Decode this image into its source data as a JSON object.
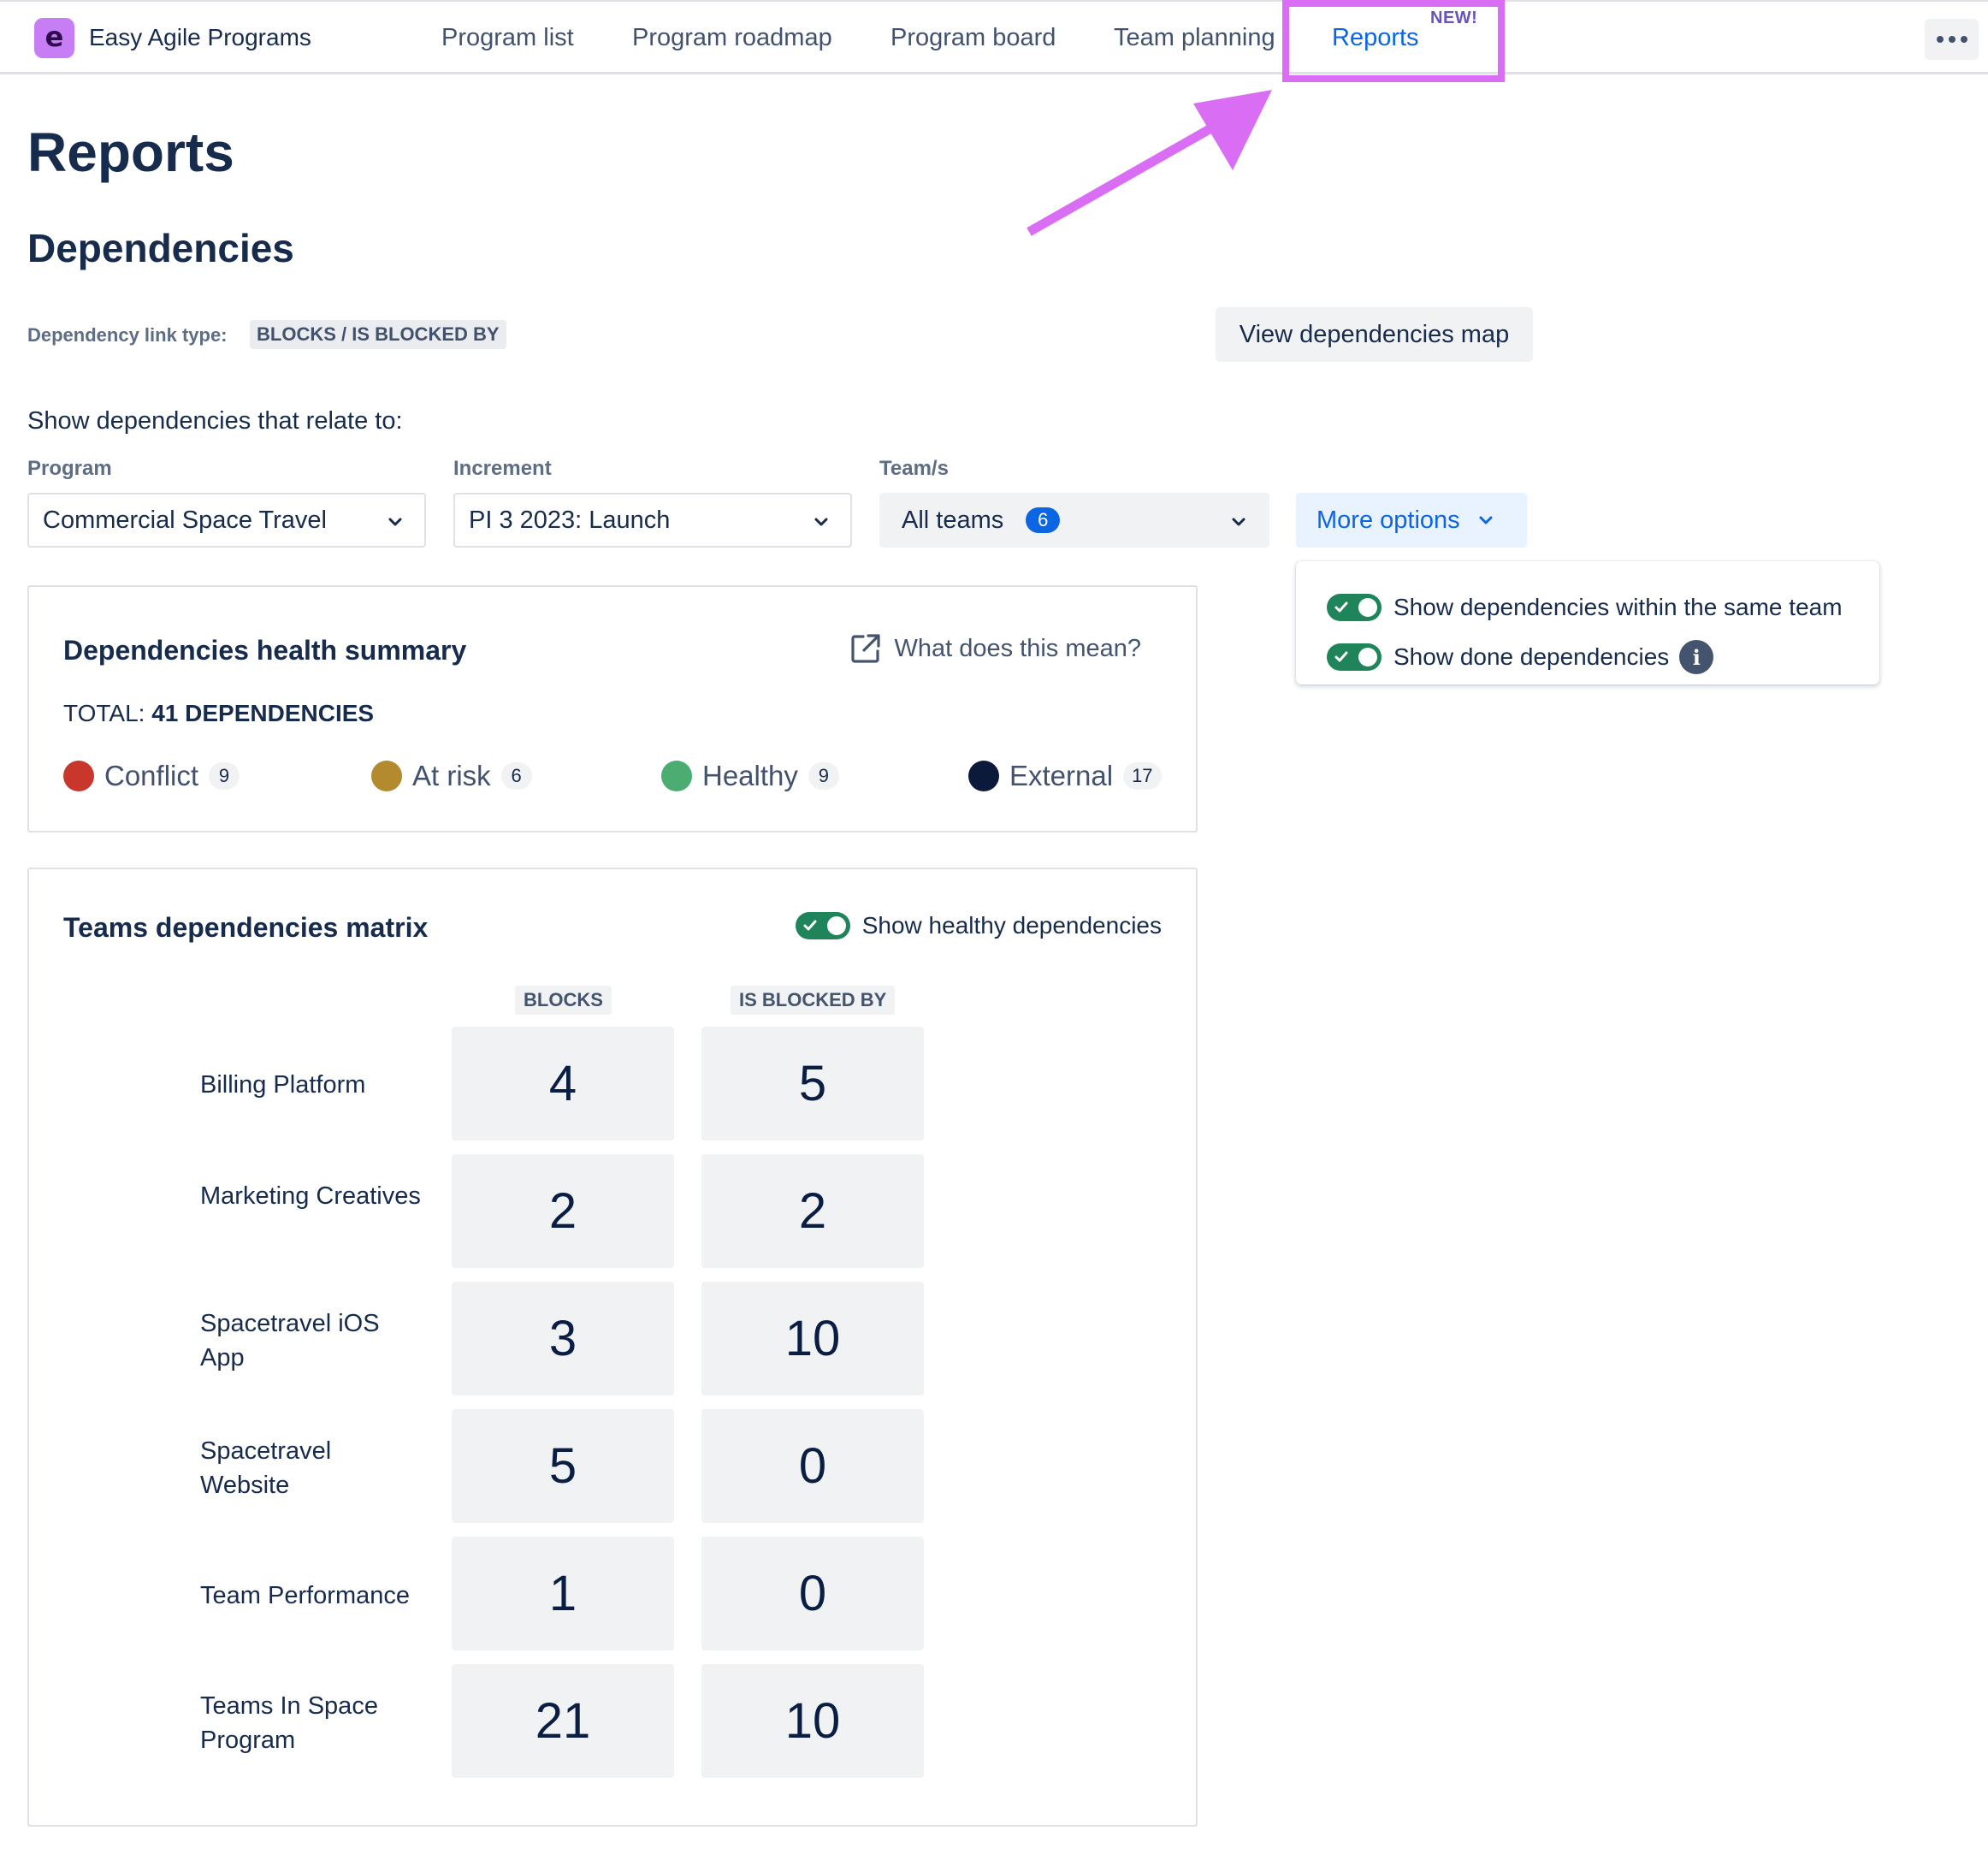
{
  "app": {
    "title": "Easy Agile Programs",
    "logo_letter": "e",
    "accent": "#d96ef5"
  },
  "nav": {
    "items": [
      {
        "label": "Program list"
      },
      {
        "label": "Program roadmap"
      },
      {
        "label": "Program board"
      },
      {
        "label": "Team planning"
      },
      {
        "label": "Reports"
      }
    ],
    "active": "Reports",
    "new_badge": "NEW!",
    "more_icon": "ellipsis-icon"
  },
  "page": {
    "title": "Reports",
    "section_title": "Dependencies",
    "link_type_label": "Dependency link type:",
    "link_type_value": "BLOCKS / IS BLOCKED BY",
    "view_map_button": "View dependencies map",
    "show_label": "Show dependencies that relate to:"
  },
  "filters": {
    "program": {
      "label": "Program",
      "value": "Commercial Space Travel"
    },
    "increment": {
      "label": "Increment",
      "value": "PI 3 2023: Launch"
    },
    "teams": {
      "label": "Team/s",
      "value": "All teams",
      "count": "6"
    },
    "more_options": {
      "label": "More options",
      "options": [
        {
          "label": "Show dependencies within the same team",
          "enabled": true
        },
        {
          "label": "Show done dependencies",
          "enabled": true,
          "info_icon": "info-icon"
        }
      ]
    }
  },
  "health_summary": {
    "title": "Dependencies health summary",
    "help_link": "What does this mean?",
    "total_prefix": "TOTAL:",
    "total_value": "41 DEPENDENCIES",
    "statuses": [
      {
        "label": "Conflict",
        "count": "9",
        "color": "#c9372c"
      },
      {
        "label": "At risk",
        "count": "6",
        "color": "#b38a2e"
      },
      {
        "label": "Healthy",
        "count": "9",
        "color": "#4bad72"
      },
      {
        "label": "External",
        "count": "17",
        "color": "#0b1a3b"
      }
    ]
  },
  "matrix": {
    "title": "Teams dependencies matrix",
    "healthy_toggle_label": "Show healthy dependencies",
    "healthy_toggle_on": true,
    "columns": [
      "BLOCKS",
      "IS BLOCKED BY"
    ],
    "rows": [
      {
        "team": "Billing Platform",
        "blocks": "4",
        "blocked_by": "5"
      },
      {
        "team": "Marketing Creatives",
        "blocks": "2",
        "blocked_by": "2"
      },
      {
        "team": "Spacetravel iOS App",
        "blocks": "3",
        "blocked_by": "10"
      },
      {
        "team": "Spacetravel Website",
        "blocks": "5",
        "blocked_by": "0"
      },
      {
        "team": "Team Performance",
        "blocks": "1",
        "blocked_by": "0"
      },
      {
        "team": "Teams In Space Program",
        "blocks": "21",
        "blocked_by": "10"
      }
    ]
  }
}
